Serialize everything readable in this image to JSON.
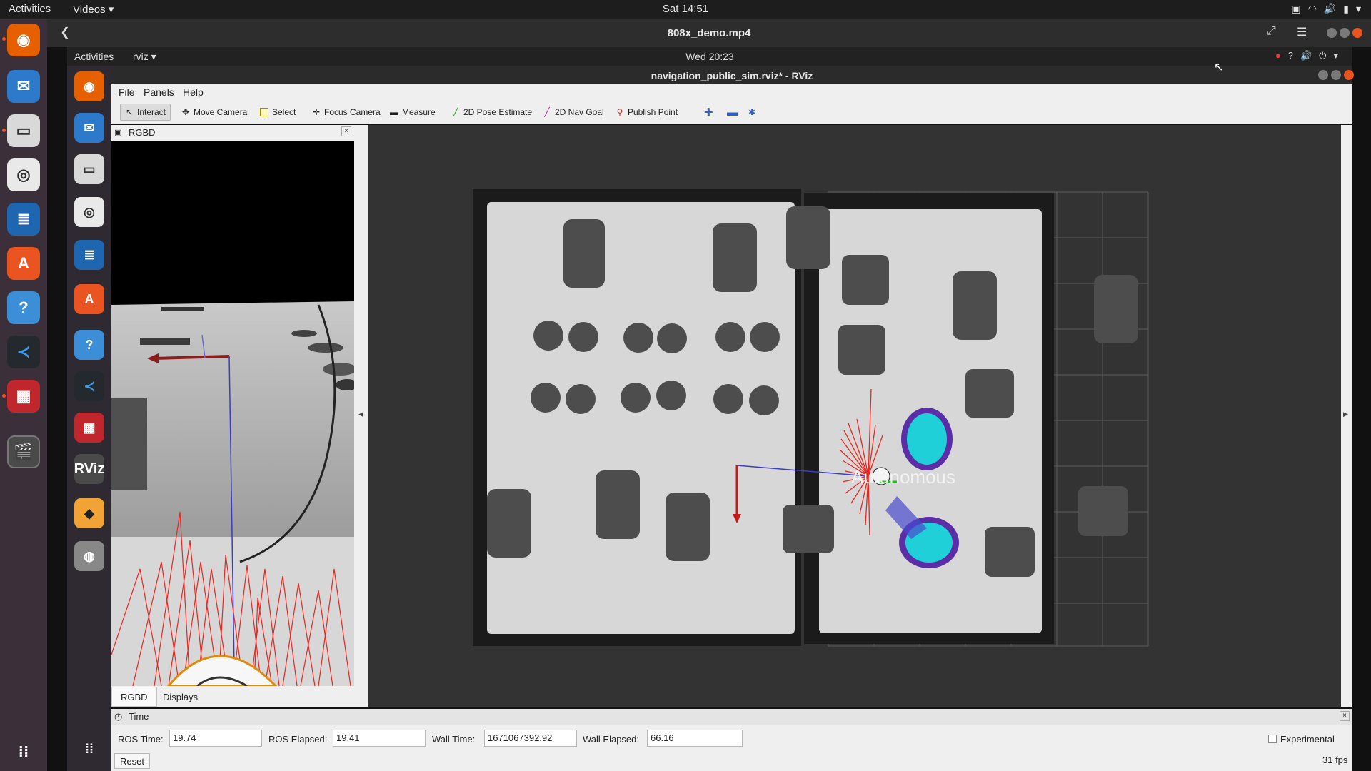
{
  "outer_topbar": {
    "activities": "Activities",
    "app_menu": "Videos ▾",
    "clock": "Sat 14:51"
  },
  "player": {
    "title": "808x_demo.mp4"
  },
  "inner_topbar": {
    "activities": "Activities",
    "app_menu": "rviz ▾",
    "clock": "Wed 20:23"
  },
  "rviz": {
    "window_title": "navigation_public_sim.rviz* - RViz",
    "menu": [
      "File",
      "Panels",
      "Help"
    ],
    "tools": [
      {
        "label": "Interact",
        "icon": "cursor-icon",
        "active": true
      },
      {
        "label": "Move Camera",
        "icon": "move-icon"
      },
      {
        "label": "Select",
        "icon": "select-box-icon"
      },
      {
        "label": "Focus Camera",
        "icon": "crosshair-icon"
      },
      {
        "label": "Measure",
        "icon": "ruler-icon"
      },
      {
        "label": "2D Pose Estimate",
        "icon": "green-arrow-icon"
      },
      {
        "label": "2D Nav Goal",
        "icon": "pink-arrow-icon"
      },
      {
        "label": "Publish Point",
        "icon": "pin-icon"
      }
    ],
    "left_panel": {
      "title": "RGBD",
      "tabs": [
        "RGBD",
        "Displays"
      ]
    },
    "map_label": "Autonomous",
    "time_panel": {
      "title": "Time",
      "ros_time_label": "ROS Time:",
      "ros_time": "19.74",
      "ros_elapsed_label": "ROS Elapsed:",
      "ros_elapsed": "19.41",
      "wall_time_label": "Wall Time:",
      "wall_time": "1671067392.92",
      "wall_elapsed_label": "Wall Elapsed:",
      "wall_elapsed": "66.16",
      "experimental": "Experimental",
      "reset": "Reset",
      "fps": "31 fps"
    }
  },
  "colors": {
    "ubuntu_orange": "#e95420",
    "dock": "#3b2f39",
    "cyan": "#1fd0d8",
    "laser": "#e8271f"
  }
}
